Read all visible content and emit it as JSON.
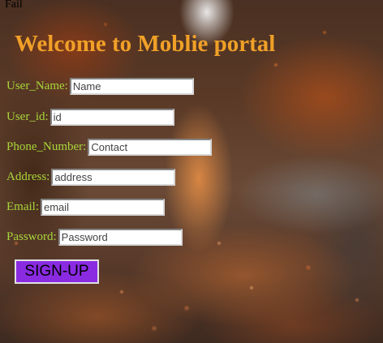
{
  "top_text": "Fail",
  "page": {
    "title": "Welcome to Moblie portal"
  },
  "form": {
    "fields": [
      {
        "label": "User_Name:",
        "placeholder": "Name"
      },
      {
        "label": "User_id:",
        "placeholder": "id"
      },
      {
        "label": "Phone_Number:",
        "placeholder": "Contact"
      },
      {
        "label": "Address:",
        "placeholder": "address"
      },
      {
        "label": "Email:",
        "placeholder": "email"
      },
      {
        "label": "Password:",
        "placeholder": "Password"
      }
    ],
    "submit_label": "SIGN-UP"
  },
  "colors": {
    "title": "#f0a028",
    "label": "#a8d63a",
    "button": "#8a2be2"
  }
}
